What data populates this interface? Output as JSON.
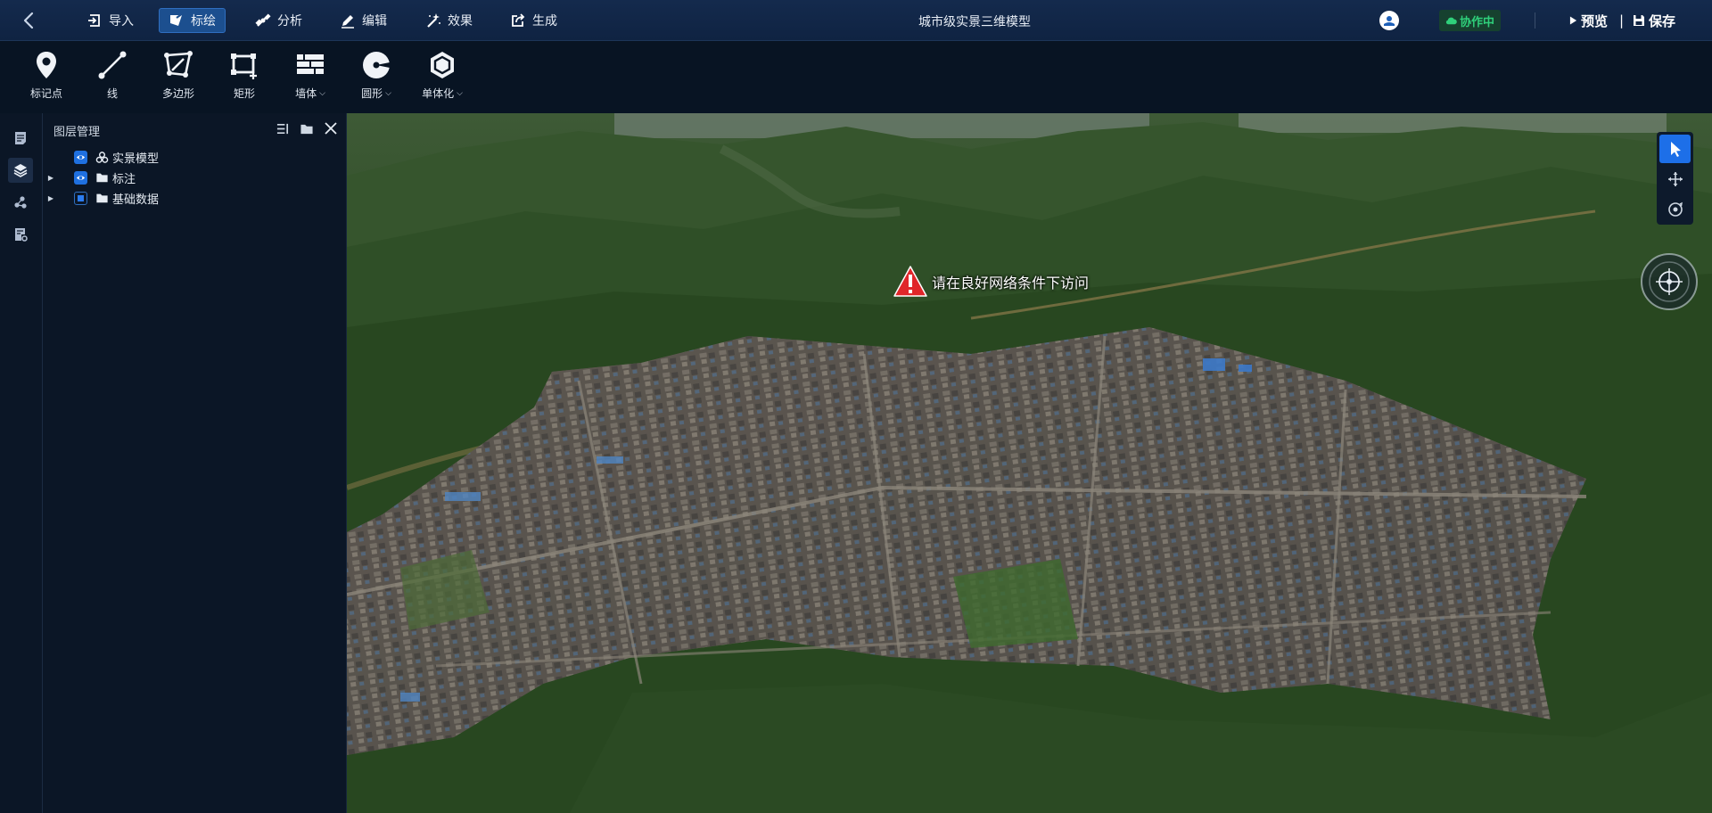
{
  "app": {
    "title": "城市级实景三维模型"
  },
  "menu": [
    {
      "label": "导入",
      "icon": "import-icon"
    },
    {
      "label": "标绘",
      "icon": "plot-icon",
      "active": true
    },
    {
      "label": "分析",
      "icon": "satellite-icon"
    },
    {
      "label": "编辑",
      "icon": "pencil-icon"
    },
    {
      "label": "效果",
      "icon": "magic-wand-icon"
    },
    {
      "label": "生成",
      "icon": "export-icon"
    }
  ],
  "top_right": {
    "collab": "协作中",
    "preview": "预览",
    "divider": "|",
    "save": "保存"
  },
  "tools": [
    {
      "label": "标记点",
      "icon": "map-pin-icon"
    },
    {
      "label": "线",
      "icon": "line-icon"
    },
    {
      "label": "多边形",
      "icon": "polygon-icon"
    },
    {
      "label": "矩形",
      "icon": "rectangle-icon"
    },
    {
      "label": "墙体",
      "icon": "wall-icon",
      "dropdown": true
    },
    {
      "label": "圆形",
      "icon": "circle-icon",
      "dropdown": true
    },
    {
      "label": "单体化",
      "icon": "hexagon-icon",
      "dropdown": true
    }
  ],
  "layer_panel": {
    "title": "图层管理",
    "layers": [
      {
        "label": "实景模型",
        "icon": "model-icon",
        "visible": "visible",
        "expandable": false
      },
      {
        "label": "标注",
        "icon": "folder-icon",
        "visible": "visible",
        "expandable": true
      },
      {
        "label": "基础数据",
        "icon": "folder-icon",
        "visible": "partial",
        "expandable": true
      }
    ]
  },
  "viewport": {
    "warning": "请在良好网络条件下访问"
  }
}
